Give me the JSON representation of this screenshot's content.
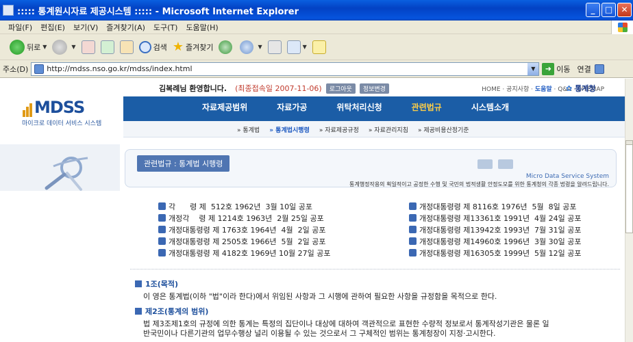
{
  "window": {
    "title": "::::: 통계원시자료 제공시스템 ::::: - Microsoft Internet Explorer",
    "minimize": "_",
    "maximize": "□",
    "close": "✕"
  },
  "menu": [
    "파일(F)",
    "편집(E)",
    "보기(V)",
    "즐겨찾기(A)",
    "도구(T)",
    "도움말(H)"
  ],
  "toolbar": {
    "back": "뒤로",
    "search": "검색",
    "favorites": "즐겨찾기"
  },
  "address": {
    "label": "주소(D)",
    "url": "http://mdss.nso.go.kr/mdss/index.html",
    "go": "이동",
    "links": "연결"
  },
  "site": {
    "user": "김복례",
    "welcome_suffix": "님 환영합니다.",
    "last_login": "(최종접속일 2007-11-06)",
    "logout_button": "로그아웃",
    "info_button": "정보변경",
    "top_links_pre": "HOME · 공지사항 · ",
    "top_links_help": "도움말",
    "top_links_post": " · Q&A · SITEMAP",
    "stat_logo": "통계청",
    "logo_word": "MDSS",
    "logo_sub": "마이크로 데이터 서비스 시스템"
  },
  "nav": {
    "tabs": [
      {
        "label": "자료제공범위"
      },
      {
        "label": "자료가공"
      },
      {
        "label": "위탁처리신청"
      },
      {
        "label": "관련법규"
      },
      {
        "label": "시스템소개"
      }
    ],
    "subitems": [
      {
        "label": "» 통계법"
      },
      {
        "label": "» 통계법시행령"
      },
      {
        "label": "» 자료제공규정"
      },
      {
        "label": "» 자료관리지침"
      },
      {
        "label": "» 제공비용산정기준"
      }
    ]
  },
  "header": {
    "tag": "관련법규 : 통계법 시행령",
    "system": "Micro Data Service System",
    "desc": "통계행정작용의 획일적이고 공정한 수행 및 국민의 법적생활 안정도모를 위한 통계청의 각종 법령을 알려드립니다."
  },
  "decrees": [
    {
      "left": "각      령 제  512호 1962년  3월 10일 공포",
      "right": "개정대통령령 제 8116호 1976년  5월  8일 공포"
    },
    {
      "left": "개정각    령 제 1214호 1963년  2월 25일 공포",
      "right": "개정대통령령 제13361호 1991년  4월 24일 공포"
    },
    {
      "left": "개정대통령령 제 1763호 1964년  4월  2일 공포",
      "right": "개정대통령령 제13942호 1993년  7월 31일 공포"
    },
    {
      "left": "개정대통령령 제 2505호 1966년  5월  2일 공포",
      "right": "개정대통령령 제14960호 1996년  3월 30일 공포"
    },
    {
      "left": "개정대통령령 제 4182호 1969년 10월 27일 공포",
      "right": "개정대통령령 제16305호 1999년  5월 12일 공포"
    }
  ],
  "articles": [
    {
      "title": "1조(목적)",
      "text1": "이 영은 통계법(이하 \"법\"이라 한다)에서 위임된 사항과 그 시행에 관하여 필요한 사항을 규정함을 목적으로 한다.",
      "text2": ""
    },
    {
      "title": "제2조(통계의 범위)",
      "text1": "법 제3조제1호의 규정에 의한 통계는 특정의 집단이나 대상에 대하여 객관적으로 표현한 수량적 정보로서 통계작성기관은 물론 일",
      "text2": "반국민이나 다른기관의 업무수행상 널리 이용될 수 있는 것으로서 그 구체적인 범위는 통계청장이 지정·고시한다."
    }
  ]
}
